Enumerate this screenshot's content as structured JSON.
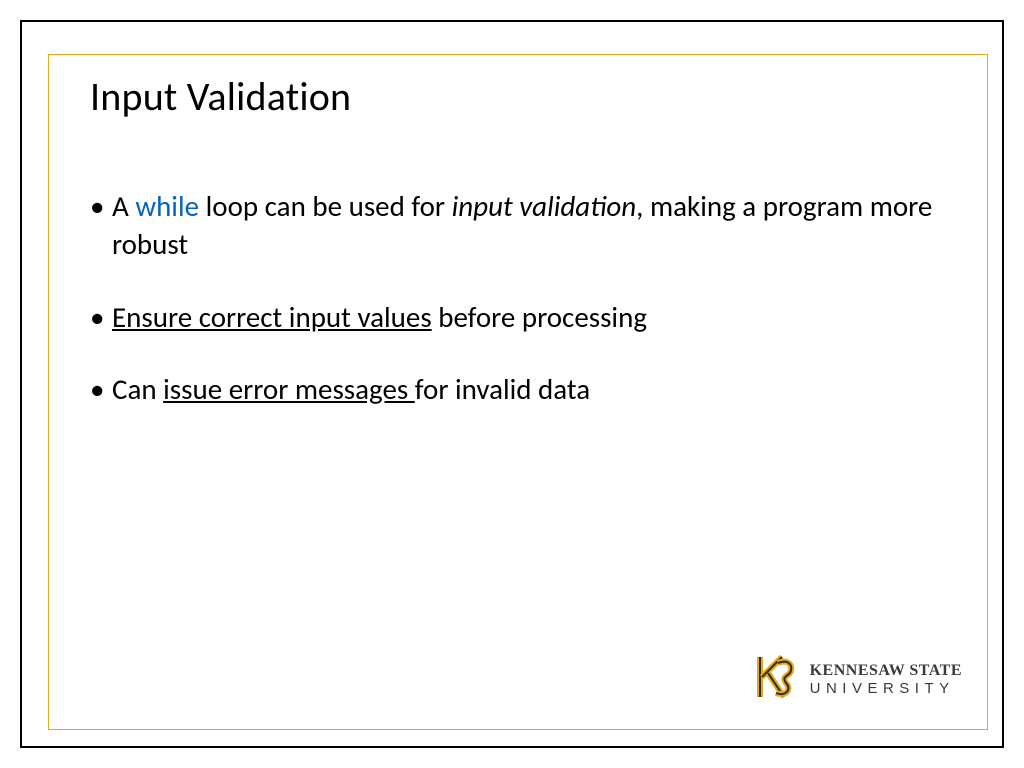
{
  "slide": {
    "title": "Input Validation",
    "bullets": [
      {
        "segments": [
          {
            "text": "A "
          },
          {
            "text": "while",
            "style": "kw-blue"
          },
          {
            "text": " loop can be used for "
          },
          {
            "text": "input validation",
            "style": "italic"
          },
          {
            "text": ", making a program more robust"
          }
        ]
      },
      {
        "segments": [
          {
            "text": "Ensure correct input values",
            "style": "underline"
          },
          {
            "text": " before processing"
          }
        ]
      },
      {
        "segments": [
          {
            "text": "Can "
          },
          {
            "text": "issue error messages ",
            "style": "underline"
          },
          {
            "text": "for invalid data"
          }
        ]
      }
    ]
  },
  "branding": {
    "org_line1": "KENNESAW STATE",
    "org_line2": "UNIVERSITY",
    "logo_icon": "ks-interlock-icon",
    "colors": {
      "gold": "#e6a817",
      "dark": "#2b2b2b"
    }
  }
}
